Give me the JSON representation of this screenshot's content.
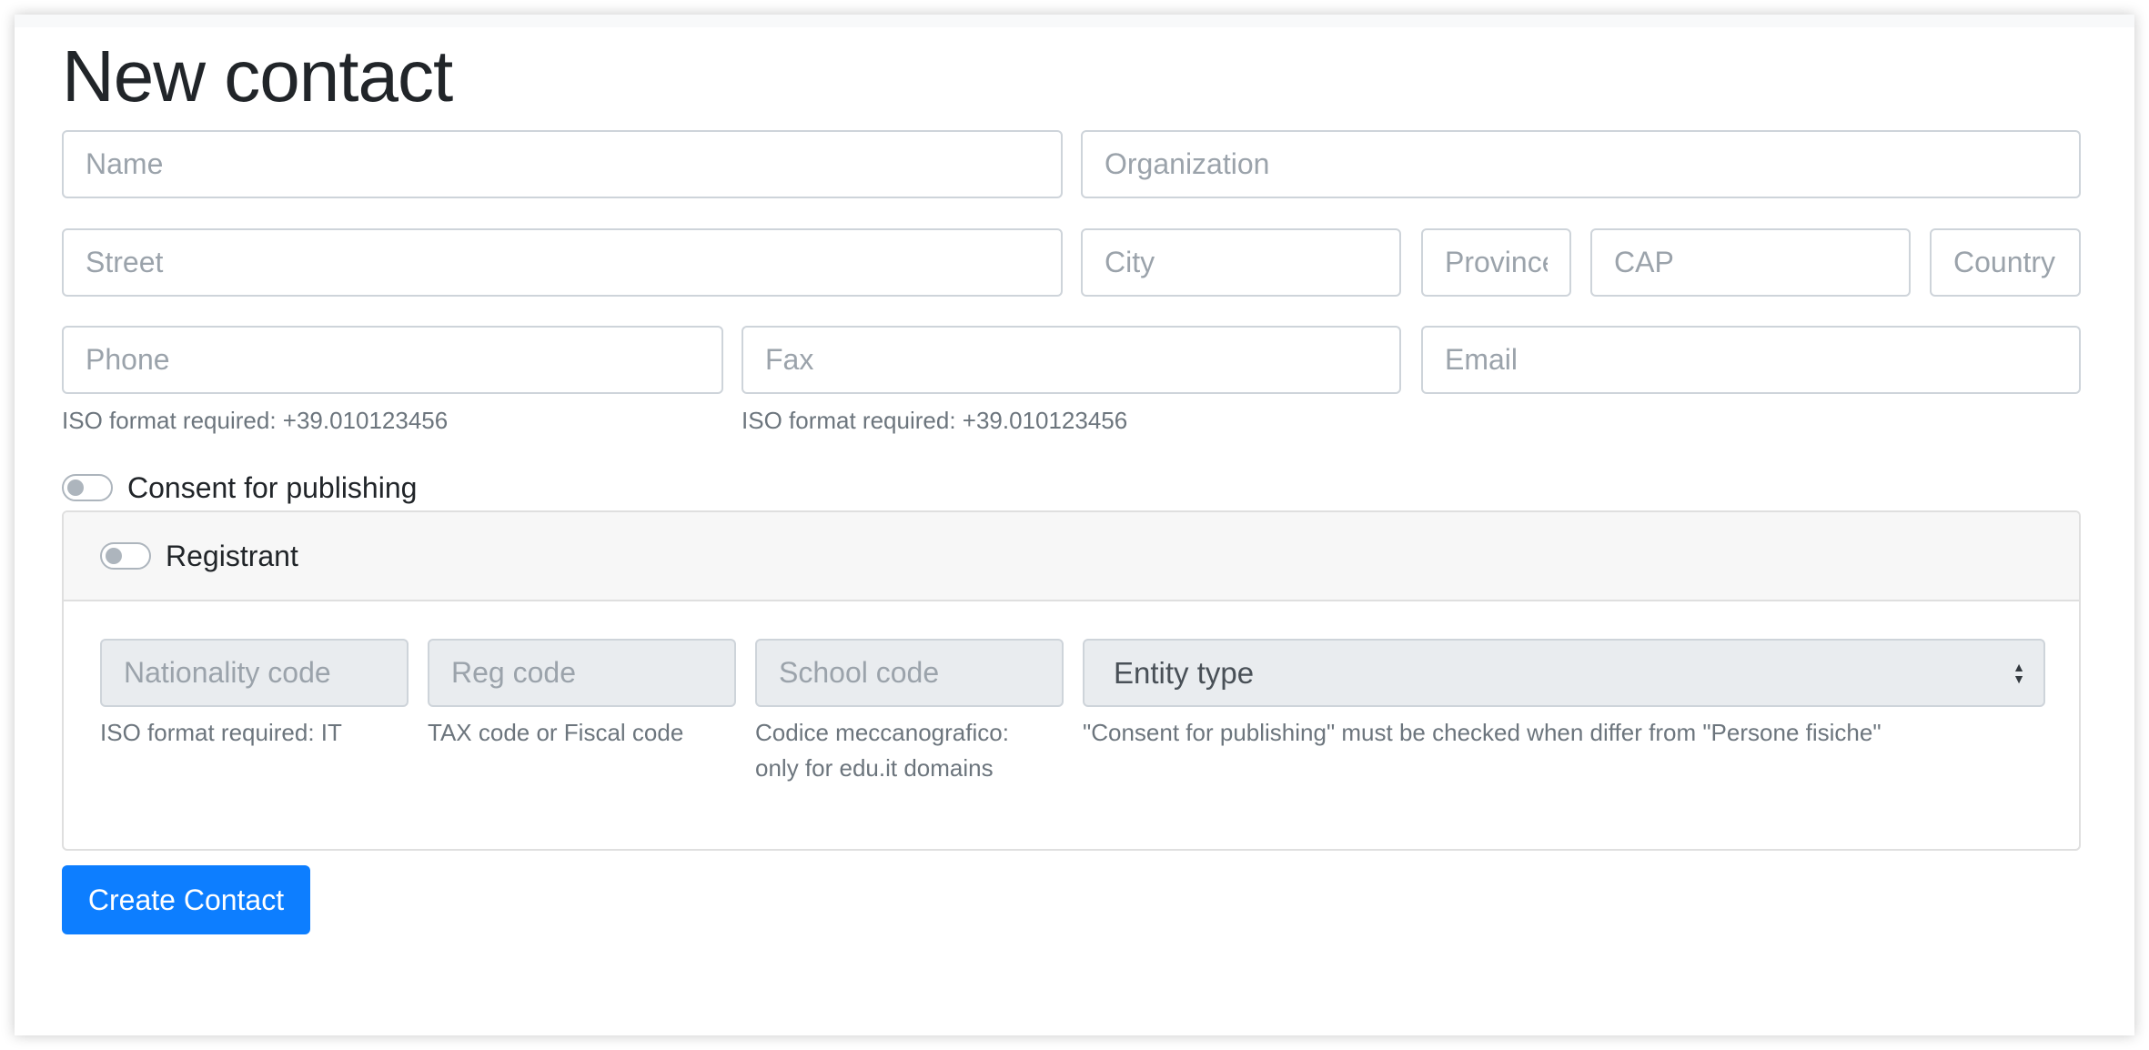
{
  "page": {
    "title": "New contact"
  },
  "form": {
    "name": {
      "placeholder": "Name",
      "value": ""
    },
    "organization": {
      "placeholder": "Organization",
      "value": ""
    },
    "street": {
      "placeholder": "Street",
      "value": ""
    },
    "city": {
      "placeholder": "City",
      "value": ""
    },
    "province": {
      "placeholder": "Province",
      "value": ""
    },
    "cap": {
      "placeholder": "CAP",
      "value": ""
    },
    "country": {
      "placeholder": "Country",
      "value": ""
    },
    "phone": {
      "placeholder": "Phone",
      "value": "",
      "help": "ISO format required: +39.010123456"
    },
    "fax": {
      "placeholder": "Fax",
      "value": "",
      "help": "ISO format required: +39.010123456"
    },
    "email": {
      "placeholder": "Email",
      "value": ""
    },
    "consent": {
      "label": "Consent for publishing",
      "checked": false
    }
  },
  "registrant": {
    "toggle": {
      "label": "Registrant",
      "checked": false
    },
    "nationality_code": {
      "placeholder": "Nationality code",
      "value": "",
      "help": "ISO format required: IT",
      "disabled": true
    },
    "reg_code": {
      "placeholder": "Reg code",
      "value": "",
      "help": "TAX code or Fiscal code",
      "disabled": true
    },
    "school_code": {
      "placeholder": "School code",
      "value": "",
      "help_line1": "Codice meccanografico:",
      "help_line2": "only for edu.it domains",
      "disabled": true
    },
    "entity_type": {
      "selected": "Entity type",
      "help": "\"Consent for publishing\" must be checked when differ from \"Persone fisiche\"",
      "icon": "select-arrows-icon",
      "disabled": true
    }
  },
  "actions": {
    "submit_label": "Create Contact"
  },
  "colors": {
    "primary": "#0d7eff",
    "border": "#ced4da",
    "disabled_bg": "#e9ecef",
    "help_text": "#6c757d",
    "card_header_bg": "#f7f7f7"
  }
}
